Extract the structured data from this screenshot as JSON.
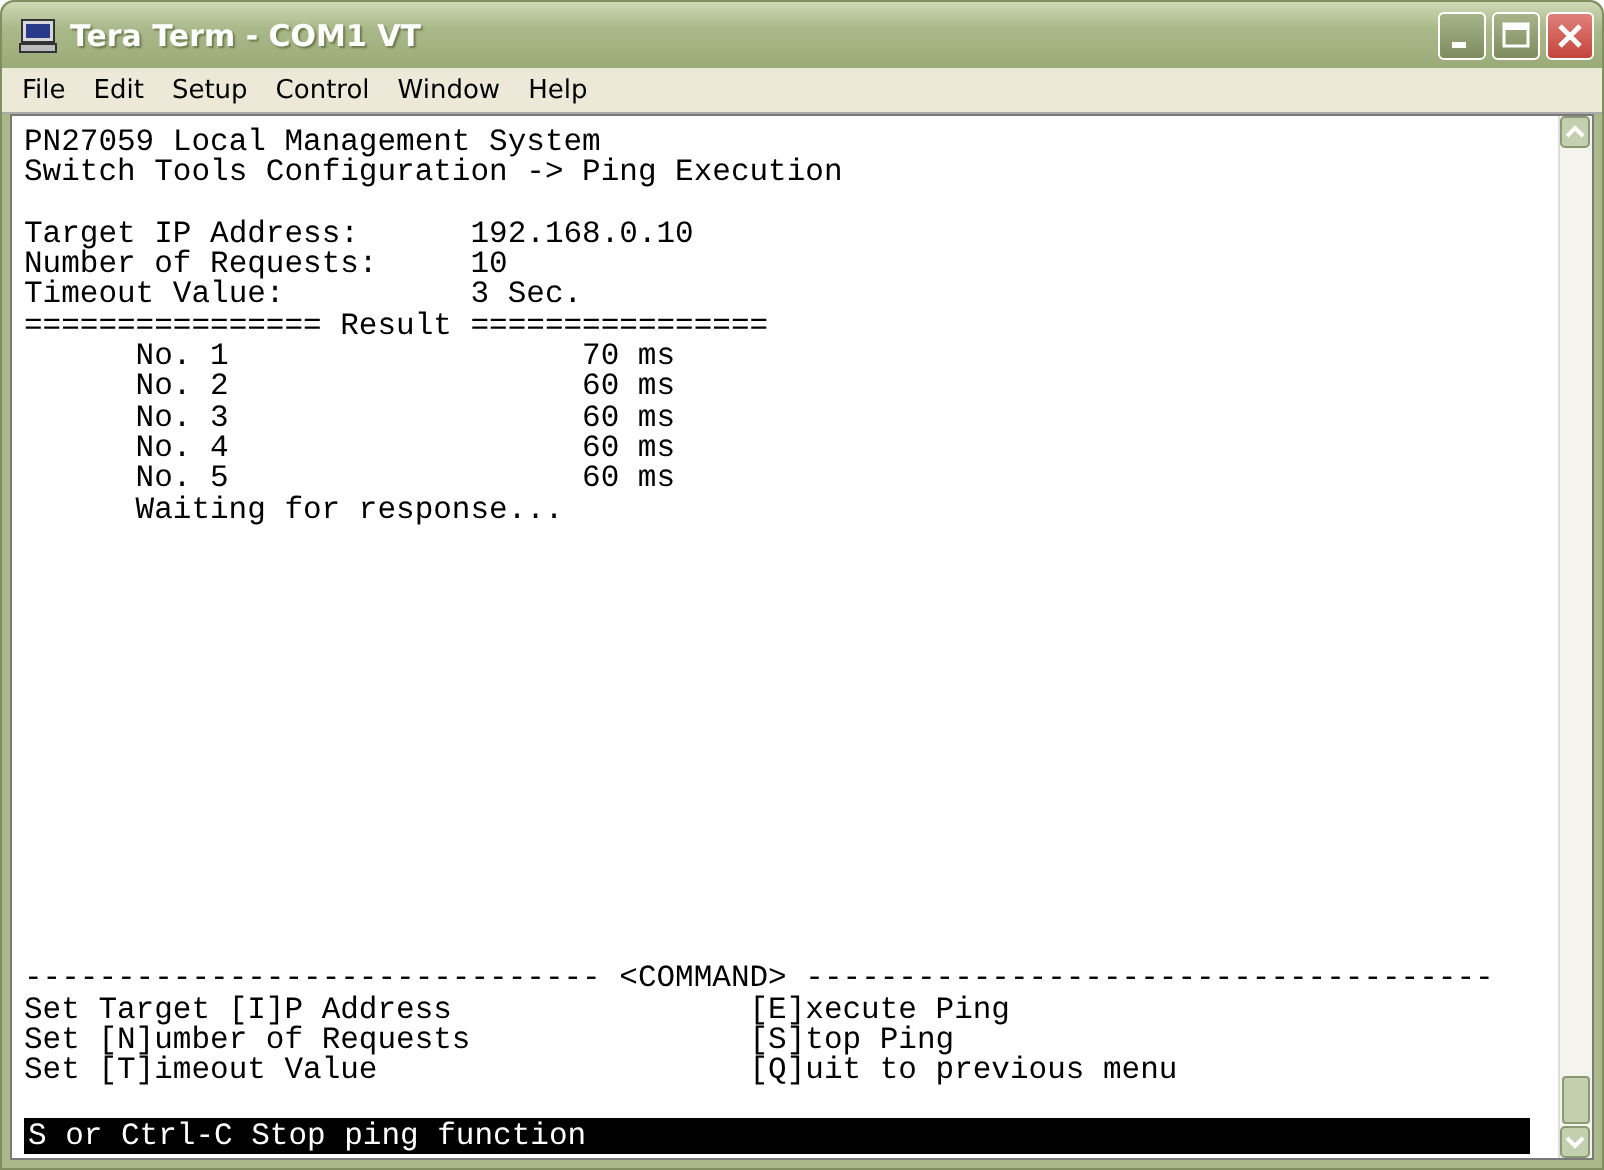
{
  "window": {
    "title": "Tera Term - COM1 VT"
  },
  "menu": [
    {
      "label": "File"
    },
    {
      "label": "Edit"
    },
    {
      "label": "Setup"
    },
    {
      "label": "Control"
    },
    {
      "label": "Window"
    },
    {
      "label": "Help"
    }
  ],
  "terminal": {
    "header": [
      "PN27059 Local Management System",
      "Switch Tools Configuration -> Ping Execution"
    ],
    "settings": [
      {
        "label": "Target IP Address:",
        "value": "192.168.0.10"
      },
      {
        "label": "Number of Requests:",
        "value": "10"
      },
      {
        "label": "Timeout Value:",
        "value": "3 Sec."
      }
    ],
    "result_divider": "================ Result ================",
    "results": [
      {
        "label": "No. 1",
        "value": "70 ms"
      },
      {
        "label": "No. 2",
        "value": "60 ms"
      },
      {
        "label": "No. 3",
        "value": "60 ms"
      },
      {
        "label": "No. 4",
        "value": "60 ms"
      },
      {
        "label": "No. 5",
        "value": "60 ms"
      }
    ],
    "waiting": "Waiting for response...",
    "command_divider": "------------------------------- <COMMAND> -------------------------------------",
    "commands_left": [
      "Set Target [I]P Address",
      "Set [N]umber of Requests",
      "Set [T]imeout Value"
    ],
    "commands_right": [
      "[E]xecute Ping",
      "[S]top Ping",
      "[Q]uit to previous menu"
    ],
    "status_line": "S or Ctrl-C Stop ping function"
  }
}
